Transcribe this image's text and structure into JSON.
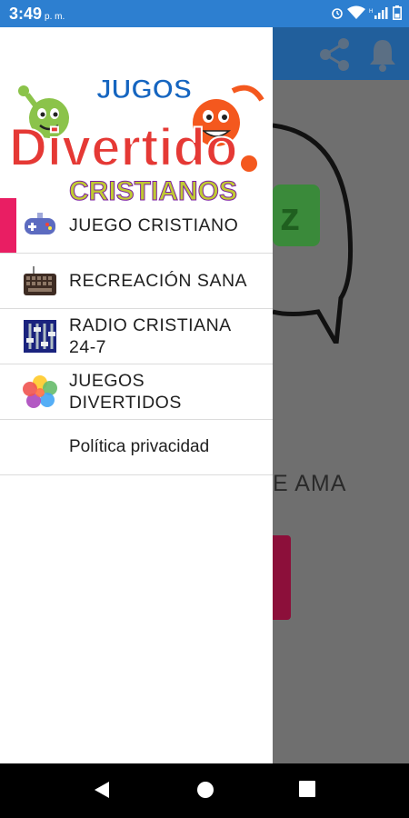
{
  "status_bar": {
    "time": "3:49",
    "ampm": "p. m.",
    "icons": [
      "alarm-icon",
      "wifi-icon",
      "signal-icon",
      "battery-icon"
    ]
  },
  "app_bar": {
    "actions": [
      "share-icon",
      "notifications-icon"
    ]
  },
  "background": {
    "partial_text": "E AMA"
  },
  "drawer": {
    "logo": {
      "line1": "JUGOS",
      "line2": "Divertido",
      "line3": "CRISTIANOS"
    },
    "items": [
      {
        "label": "JUEGO CRISTIANO",
        "icon": "gamepad-icon",
        "active": true
      },
      {
        "label": "RECREACIÓN SANA",
        "icon": "keyboard-icon",
        "active": false
      },
      {
        "label_line1": "RADIO CRISTIANA",
        "label_line2": "24-7",
        "icon": "equalizer-icon",
        "active": false
      },
      {
        "label_line1": "JUEGOS",
        "label_line2": "DIVERTIDOS",
        "icon": "flower-icon",
        "active": false
      },
      {
        "label": "Política privacidad",
        "icon": "",
        "active": false
      }
    ]
  },
  "colors": {
    "status_bar": "#2d7fd0",
    "app_bar": "#215f9c",
    "active_indicator": "#e91e63"
  },
  "nav_bar": {
    "buttons": [
      "back-icon",
      "home-icon",
      "recents-icon"
    ]
  }
}
